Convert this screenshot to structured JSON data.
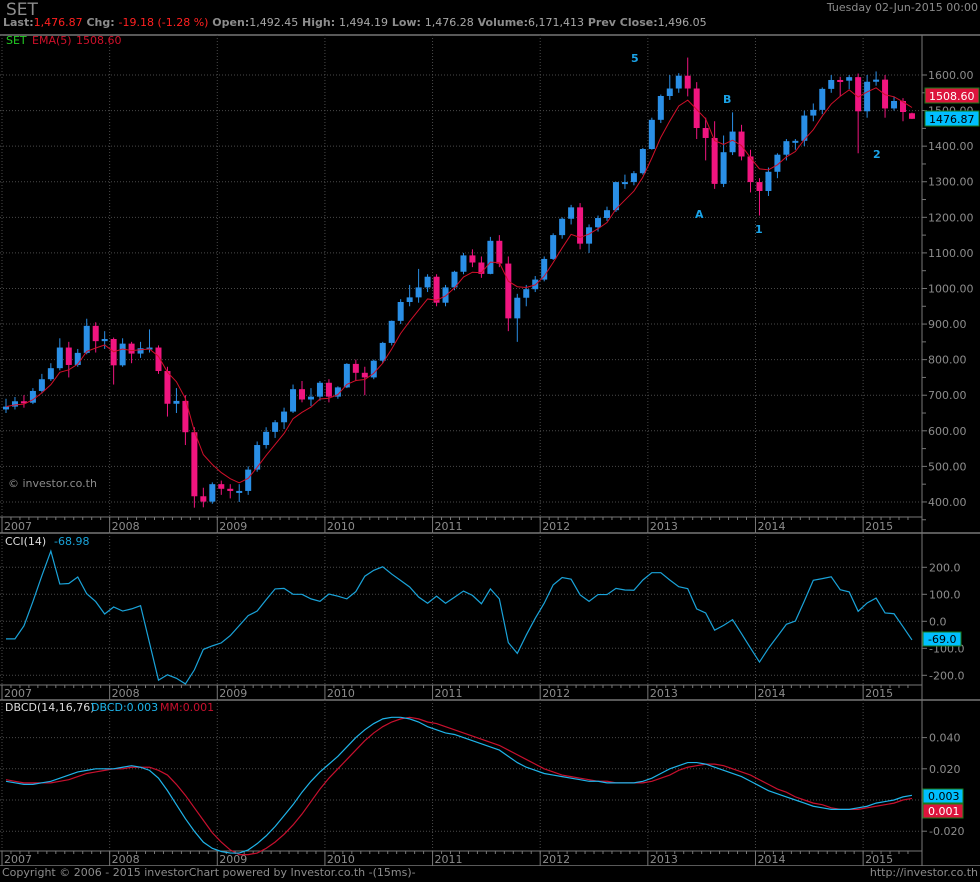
{
  "header": {
    "symbol": "SET",
    "last_label": "Last:",
    "last_value": "1,476.87",
    "chg_label": "Chg:",
    "chg_value": "-19.18 (-1.28 %)",
    "open_label": "Open:",
    "open_value": "1,492.45",
    "high_label": "High:",
    "high_value": "1,494.19",
    "low_label": "Low:",
    "low_value": "1,476.28",
    "volume_label": "Volume:",
    "volume_value": "6,171,413",
    "prev_close_label": "Prev Close:",
    "prev_close_value": "1,496.05",
    "date": "Tuesday 02-Jun-2015 00:00"
  },
  "footer": {
    "copyright": "Copyright © 2006 - 2015 investorChart powered by Investor.co.th -(15ms)-",
    "url": "http://investor.co.th"
  },
  "colors": {
    "up": "#2a8fe6",
    "down": "#f0157f",
    "ema": "#d0102a",
    "cci": "#1aa3d9",
    "dbcd": "#1fb4ea",
    "mm": "#c8102e",
    "grid": "#4a4a4a"
  },
  "chart_data": [
    {
      "type": "candlestick",
      "title": "SET",
      "legend": {
        "symbol": "SET",
        "ema_label": "EMA(5)",
        "ema_value": "1508.60"
      },
      "watermark": "© investor.co.th",
      "frequency": "monthly",
      "start": "2007-01",
      "years": [
        "2007",
        "2008",
        "2009",
        "2010",
        "2011",
        "2012",
        "2013",
        "2014",
        "2015"
      ],
      "y_ticks": [
        "400.00",
        "500.00",
        "600.00",
        "700.00",
        "800.00",
        "900.00",
        "1000.00",
        "1100.00",
        "1200.00",
        "1300.00",
        "1400.00",
        "1500.00",
        "1600.00"
      ],
      "ylim": [
        370,
        1700
      ],
      "badges": {
        "ema": "1508.60",
        "last": "1476.87"
      },
      "annotations": [
        "5",
        "B",
        "A",
        "1",
        "2"
      ],
      "ohlc": [
        [
          660,
          690,
          650,
          668
        ],
        [
          668,
          695,
          660,
          683
        ],
        [
          683,
          700,
          665,
          679
        ],
        [
          679,
          720,
          675,
          712
        ],
        [
          712,
          760,
          705,
          745
        ],
        [
          745,
          790,
          740,
          776
        ],
        [
          776,
          860,
          770,
          834
        ],
        [
          834,
          850,
          750,
          785
        ],
        [
          785,
          830,
          780,
          819
        ],
        [
          819,
          915,
          815,
          895
        ],
        [
          895,
          905,
          820,
          852
        ],
        [
          852,
          880,
          830,
          858
        ],
        [
          858,
          862,
          730,
          784
        ],
        [
          784,
          860,
          780,
          845
        ],
        [
          845,
          850,
          790,
          817
        ],
        [
          817,
          850,
          805,
          832
        ],
        [
          832,
          885,
          820,
          834
        ],
        [
          834,
          840,
          760,
          768
        ],
        [
          768,
          780,
          640,
          676
        ],
        [
          676,
          720,
          650,
          684
        ],
        [
          684,
          700,
          560,
          596
        ],
        [
          596,
          610,
          384,
          416
        ],
        [
          416,
          440,
          385,
          401
        ],
        [
          401,
          455,
          395,
          450
        ],
        [
          450,
          460,
          420,
          437
        ],
        [
          437,
          450,
          410,
          431
        ],
        [
          431,
          450,
          400,
          431
        ],
        [
          431,
          500,
          420,
          491
        ],
        [
          491,
          570,
          485,
          560
        ],
        [
          560,
          610,
          550,
          597
        ],
        [
          597,
          630,
          580,
          624
        ],
        [
          624,
          665,
          605,
          654
        ],
        [
          654,
          730,
          650,
          717
        ],
        [
          717,
          740,
          680,
          688
        ],
        [
          688,
          720,
          670,
          696
        ],
        [
          696,
          740,
          685,
          735
        ],
        [
          735,
          745,
          680,
          696
        ],
        [
          696,
          725,
          690,
          722
        ],
        [
          722,
          790,
          720,
          788
        ],
        [
          788,
          800,
          740,
          763
        ],
        [
          763,
          780,
          700,
          750
        ],
        [
          750,
          800,
          745,
          797
        ],
        [
          797,
          850,
          790,
          847
        ],
        [
          847,
          910,
          840,
          909
        ],
        [
          909,
          970,
          900,
          962
        ],
        [
          962,
          1010,
          950,
          975
        ],
        [
          975,
          1055,
          960,
          1003
        ],
        [
          1003,
          1040,
          990,
          1033
        ],
        [
          1033,
          1040,
          950,
          960
        ],
        [
          960,
          1010,
          950,
          1003
        ],
        [
          1003,
          1050,
          995,
          1047
        ],
        [
          1047,
          1100,
          1040,
          1093
        ],
        [
          1093,
          1110,
          1060,
          1073
        ],
        [
          1073,
          1090,
          1030,
          1041
        ],
        [
          1041,
          1145,
          1040,
          1134
        ],
        [
          1134,
          1150,
          1060,
          1070
        ],
        [
          1070,
          1090,
          880,
          916
        ],
        [
          916,
          985,
          850,
          974
        ],
        [
          974,
          1010,
          950,
          998
        ],
        [
          998,
          1035,
          990,
          1025
        ],
        [
          1025,
          1090,
          1020,
          1083
        ],
        [
          1083,
          1155,
          1080,
          1150
        ],
        [
          1150,
          1200,
          1140,
          1196
        ],
        [
          1196,
          1235,
          1180,
          1228
        ],
        [
          1228,
          1240,
          1110,
          1126
        ],
        [
          1126,
          1180,
          1100,
          1172
        ],
        [
          1172,
          1205,
          1160,
          1198
        ],
        [
          1198,
          1230,
          1190,
          1220
        ],
        [
          1220,
          1300,
          1215,
          1299
        ],
        [
          1299,
          1320,
          1280,
          1299
        ],
        [
          1299,
          1330,
          1290,
          1324
        ],
        [
          1324,
          1395,
          1320,
          1392
        ],
        [
          1392,
          1480,
          1390,
          1474
        ],
        [
          1474,
          1545,
          1465,
          1541
        ],
        [
          1541,
          1600,
          1530,
          1562
        ],
        [
          1562,
          1605,
          1550,
          1598
        ],
        [
          1598,
          1649,
          1540,
          1562
        ],
        [
          1562,
          1580,
          1420,
          1451
        ],
        [
          1451,
          1480,
          1360,
          1423
        ],
        [
          1423,
          1470,
          1280,
          1294
        ],
        [
          1294,
          1430,
          1285,
          1383
        ],
        [
          1383,
          1495,
          1375,
          1441
        ],
        [
          1441,
          1460,
          1360,
          1371
        ],
        [
          1371,
          1390,
          1270,
          1299
        ],
        [
          1299,
          1310,
          1205,
          1274
        ],
        [
          1274,
          1340,
          1260,
          1328
        ],
        [
          1328,
          1380,
          1310,
          1376
        ],
        [
          1376,
          1420,
          1360,
          1414
        ],
        [
          1414,
          1420,
          1390,
          1415
        ],
        [
          1415,
          1500,
          1400,
          1486
        ],
        [
          1486,
          1520,
          1470,
          1502
        ],
        [
          1502,
          1565,
          1490,
          1561
        ],
        [
          1561,
          1600,
          1550,
          1586
        ],
        [
          1586,
          1595,
          1540,
          1584
        ],
        [
          1584,
          1600,
          1560,
          1594
        ],
        [
          1594,
          1604,
          1380,
          1498
        ],
        [
          1498,
          1600,
          1480,
          1581
        ],
        [
          1581,
          1610,
          1570,
          1587
        ],
        [
          1587,
          1600,
          1480,
          1506
        ],
        [
          1506,
          1540,
          1500,
          1527
        ],
        [
          1527,
          1535,
          1470,
          1496
        ],
        [
          1492.45,
          1494.19,
          1476.28,
          1476.87
        ]
      ]
    },
    {
      "type": "line",
      "title": "CCI(14)",
      "value_label": "-68.98",
      "badge": "-69.0",
      "y_ticks": [
        "200.0",
        "100.0",
        "0.0",
        "-100.0",
        "-200.0"
      ],
      "ylim": [
        -250,
        250
      ],
      "values": [
        -65,
        -65,
        -17,
        73,
        169,
        260,
        138,
        140,
        164,
        102,
        73,
        27,
        53,
        38,
        46,
        58,
        -80,
        -218,
        -198,
        -211,
        -232,
        -180,
        -104,
        -91,
        -80,
        -53,
        -16,
        21,
        38,
        80,
        120,
        122,
        100,
        100,
        83,
        74,
        101,
        93,
        83,
        110,
        167,
        189,
        202,
        175,
        151,
        127,
        90,
        67,
        93,
        67,
        89,
        112,
        96,
        65,
        120,
        83,
        -79,
        -119,
        -51,
        11,
        67,
        135,
        162,
        156,
        98,
        74,
        99,
        99,
        122,
        116,
        115,
        153,
        180,
        180,
        153,
        128,
        121,
        46,
        31,
        -33,
        -15,
        6,
        -46,
        -99,
        -151,
        -100,
        -56,
        -11,
        1,
        75,
        152,
        158,
        165,
        117,
        109,
        37,
        68,
        86,
        31,
        28,
        -20,
        -69
      ]
    },
    {
      "type": "line",
      "title": "DBCD(14,16,76)",
      "series_labels": {
        "dbcd": "DBCD:0.003",
        "mm": "MM:0.001"
      },
      "badges": {
        "dbcd": "0.003",
        "mm": "0.001"
      },
      "y_ticks": [
        "0.040",
        "0.020",
        "0.000",
        "-0.020"
      ],
      "ylim": [
        -0.035,
        0.058
      ],
      "series": [
        {
          "name": "DBCD",
          "values": [
            0.012,
            0.011,
            0.01,
            0.01,
            0.011,
            0.012,
            0.014,
            0.016,
            0.018,
            0.019,
            0.02,
            0.02,
            0.02,
            0.021,
            0.022,
            0.021,
            0.019,
            0.014,
            0.006,
            -0.003,
            -0.012,
            -0.02,
            -0.027,
            -0.031,
            -0.033,
            -0.034,
            -0.034,
            -0.032,
            -0.028,
            -0.023,
            -0.017,
            -0.01,
            -0.003,
            0.005,
            0.012,
            0.018,
            0.023,
            0.028,
            0.034,
            0.04,
            0.045,
            0.049,
            0.052,
            0.053,
            0.053,
            0.052,
            0.05,
            0.047,
            0.045,
            0.043,
            0.042,
            0.04,
            0.038,
            0.036,
            0.034,
            0.032,
            0.028,
            0.024,
            0.021,
            0.019,
            0.017,
            0.016,
            0.015,
            0.014,
            0.013,
            0.012,
            0.012,
            0.011,
            0.011,
            0.011,
            0.011,
            0.012,
            0.014,
            0.017,
            0.02,
            0.022,
            0.024,
            0.024,
            0.023,
            0.021,
            0.019,
            0.017,
            0.015,
            0.012,
            0.009,
            0.006,
            0.004,
            0.002,
            0.0,
            -0.002,
            -0.004,
            -0.005,
            -0.006,
            -0.006,
            -0.006,
            -0.005,
            -0.004,
            -0.002,
            -0.001,
            0.0,
            0.002,
            0.003
          ]
        },
        {
          "name": "MM",
          "values": [
            0.013,
            0.012,
            0.011,
            0.011,
            0.011,
            0.011,
            0.012,
            0.013,
            0.015,
            0.017,
            0.018,
            0.019,
            0.02,
            0.02,
            0.021,
            0.021,
            0.021,
            0.019,
            0.016,
            0.01,
            0.003,
            -0.005,
            -0.013,
            -0.021,
            -0.027,
            -0.032,
            -0.035,
            -0.035,
            -0.034,
            -0.031,
            -0.027,
            -0.022,
            -0.016,
            -0.009,
            -0.001,
            0.007,
            0.014,
            0.02,
            0.026,
            0.032,
            0.038,
            0.043,
            0.047,
            0.05,
            0.052,
            0.053,
            0.052,
            0.05,
            0.049,
            0.047,
            0.045,
            0.043,
            0.041,
            0.039,
            0.037,
            0.035,
            0.032,
            0.029,
            0.026,
            0.023,
            0.02,
            0.018,
            0.016,
            0.015,
            0.014,
            0.013,
            0.012,
            0.012,
            0.011,
            0.011,
            0.011,
            0.011,
            0.012,
            0.014,
            0.016,
            0.019,
            0.021,
            0.022,
            0.023,
            0.023,
            0.022,
            0.02,
            0.018,
            0.016,
            0.013,
            0.01,
            0.007,
            0.005,
            0.002,
            0.0,
            -0.002,
            -0.003,
            -0.005,
            -0.006,
            -0.006,
            -0.006,
            -0.005,
            -0.004,
            -0.003,
            -0.002,
            0.0,
            0.001
          ]
        }
      ]
    }
  ]
}
